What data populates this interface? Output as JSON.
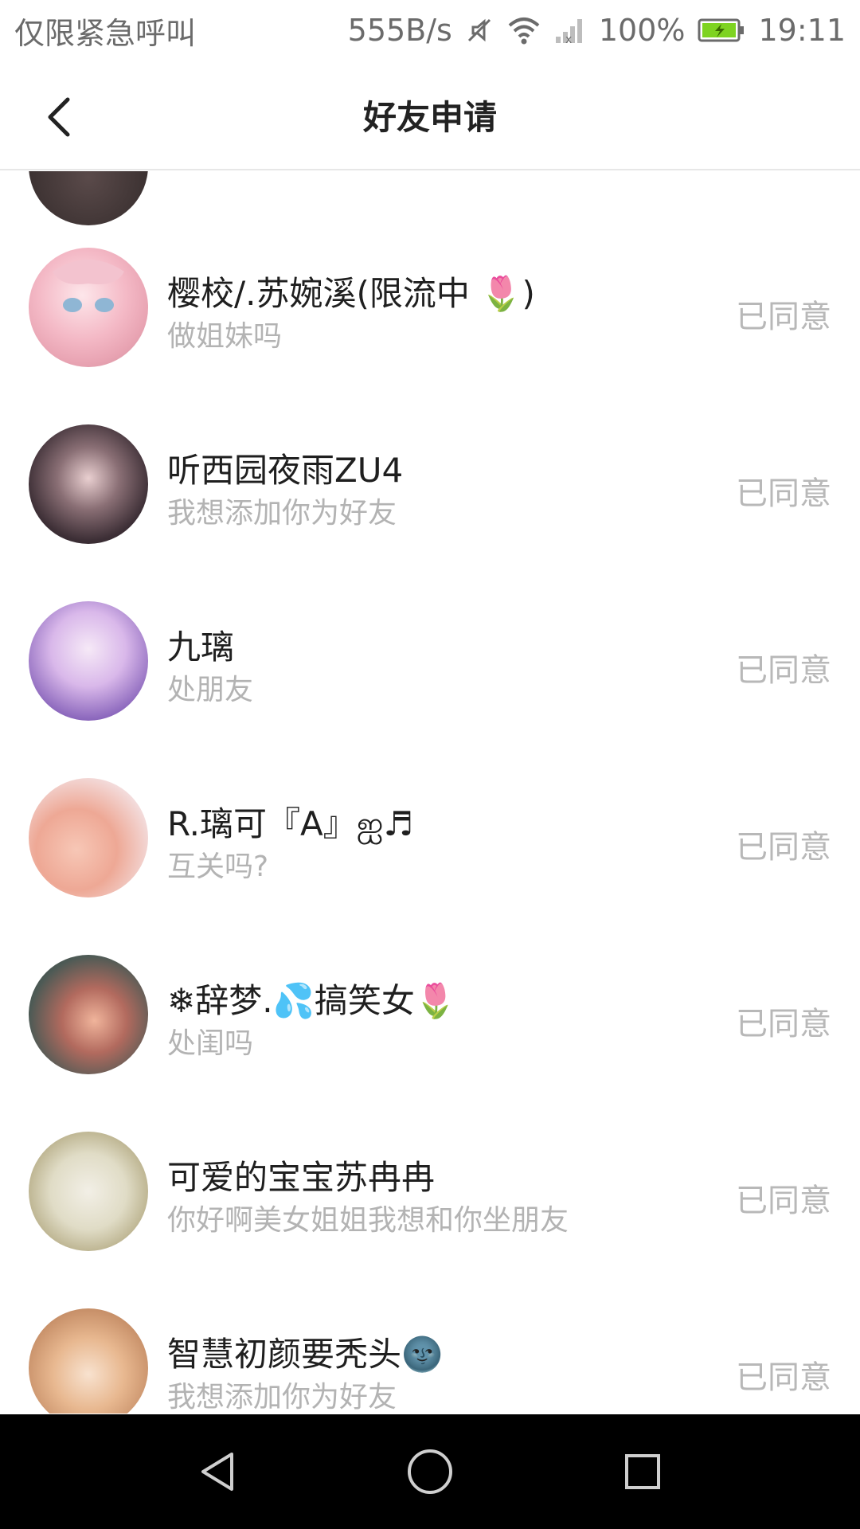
{
  "status_bar": {
    "carrier": "仅限紧急呼叫",
    "speed": "555B/s",
    "battery": "100%",
    "time": "19:11"
  },
  "header": {
    "title": "好友申请",
    "back_icon": "chevron-left-icon"
  },
  "requests": [
    {
      "name": "",
      "message": "",
      "status": "",
      "partial": true
    },
    {
      "name": "樱校/.苏婉溪(限流中 🌷)",
      "message": "做姐妹吗",
      "status": "已同意"
    },
    {
      "name": "听西园夜雨ZU4",
      "message": "我想添加你为好友",
      "status": "已同意"
    },
    {
      "name": "九璃",
      "message": "处朋友",
      "status": "已同意"
    },
    {
      "name": "R.璃可『A』ஐ♬",
      "message": "互关吗?",
      "status": "已同意"
    },
    {
      "name": "❄辞梦.💦搞笑女🌷",
      "message": "处闺吗",
      "status": "已同意"
    },
    {
      "name": "可爱的宝宝苏冉冉",
      "message": "你好啊美女姐姐我想和你坐朋友",
      "status": "已同意"
    },
    {
      "name": "智慧初颜要秃头🌚",
      "message": "我想添加你为好友",
      "status": "已同意"
    }
  ],
  "colors": {
    "accent_battery": "#7ed321",
    "muted_text": "#b3b3b3",
    "nav_bg": "#000000"
  }
}
